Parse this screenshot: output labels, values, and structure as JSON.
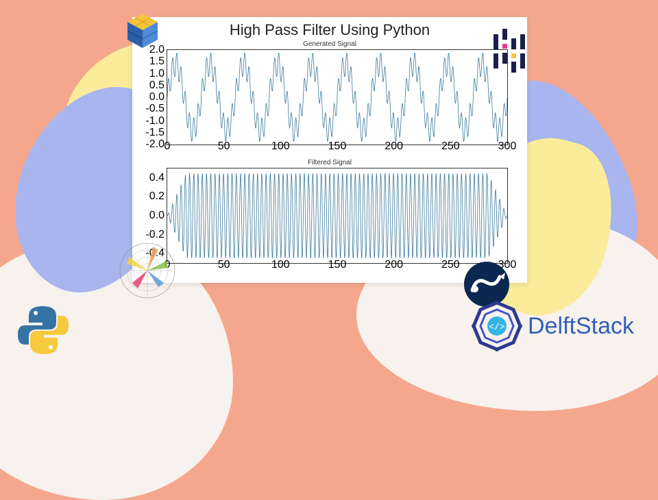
{
  "title": "High Pass Filter Using Python",
  "brand": "DelftStack",
  "chart_data": [
    {
      "type": "line",
      "title": "Generated Signal",
      "xlabel": "",
      "ylabel": "",
      "xlim": [
        0,
        300
      ],
      "ylim": [
        -2.0,
        2.0
      ],
      "x_ticks": [
        0,
        50,
        100,
        150,
        200,
        250,
        300
      ],
      "y_ticks": [
        -2.0,
        -1.5,
        -1.0,
        -0.5,
        0.0,
        0.5,
        1.0,
        1.5,
        2.0
      ],
      "description": "Sum of two sinusoids: a lower-frequency carrier at roughly 10 cycles over 300 x-units plus a higher-frequency component, amplitude envelope ≈ ±2.0",
      "components": [
        {
          "freq_cycles_over_range": 10,
          "amplitude": 1.4
        },
        {
          "freq_cycles_over_range": 80,
          "amplitude": 0.5
        }
      ]
    },
    {
      "type": "line",
      "title": "Filtered Signal",
      "xlabel": "",
      "ylabel": "",
      "xlim": [
        0,
        300
      ],
      "ylim": [
        -0.5,
        0.5
      ],
      "x_ticks": [
        0,
        50,
        100,
        150,
        200,
        250,
        300
      ],
      "y_ticks": [
        -0.4,
        -0.2,
        0.0,
        0.2,
        0.4
      ],
      "description": "High-pass filtered output: low-frequency carrier removed, dense high-frequency oscillation remains with amplitude ≈ ±0.45, slight ramp-up near x=0 and decay near x=300",
      "components": [
        {
          "freq_cycles_over_range": 80,
          "amplitude": 0.45
        }
      ]
    }
  ],
  "icons": {
    "cube": "catalyst-cube-icon",
    "pandas": "pandas-icon",
    "polar": "polar-rose-icon",
    "scipy": "scipy-icon",
    "python": "python-icon",
    "brand": "delftstack-logo"
  }
}
